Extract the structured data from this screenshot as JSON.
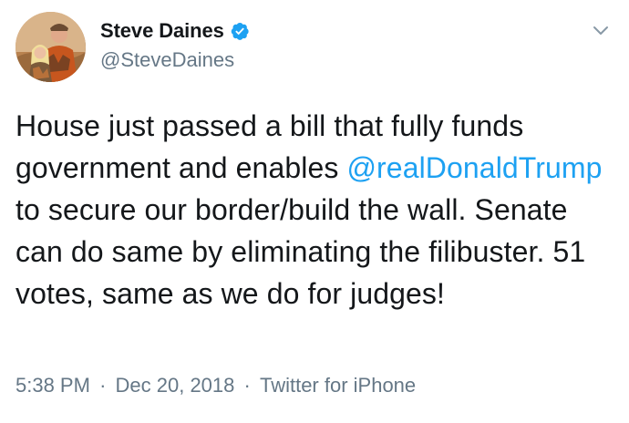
{
  "user": {
    "display_name": "Steve Daines",
    "handle": "@SteveDaines",
    "verified": true,
    "avatar_icon": "profile-photo"
  },
  "tweet": {
    "text_before": "House just passed a bill that fully funds government and enables ",
    "mention": "@realDonaldTrump",
    "text_after": " to secure our border/build the wall.  Senate can do same by eliminating the filibuster.  51 votes, same as we do for judges!",
    "time": "5:38 PM",
    "date": "Dec 20, 2018",
    "source": "Twitter for iPhone",
    "separator": "·"
  },
  "icons": {
    "verified": "verified-badge-icon",
    "menu": "chevron-down-icon"
  },
  "colors": {
    "link": "#1da1f2",
    "secondary_text": "#657786",
    "primary_text": "#14171a"
  }
}
